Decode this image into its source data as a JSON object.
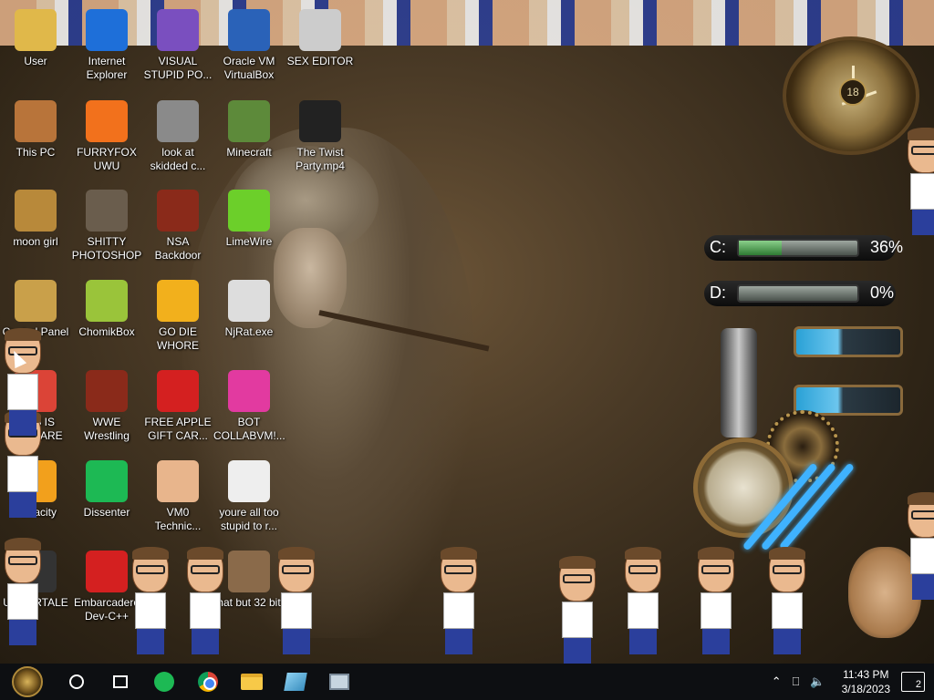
{
  "desktop": {
    "icons": [
      {
        "id": "user",
        "label": "User",
        "icon": "user-folder-icon",
        "color": "#e0b84a"
      },
      {
        "id": "ie",
        "label": "Internet Explorer",
        "icon": "internet-explorer-icon",
        "color": "#1e6fd9"
      },
      {
        "id": "vs",
        "label": "VISUAL STUPID PO...",
        "icon": "visual-studio-icon",
        "color": "#7a4fbf"
      },
      {
        "id": "vbox",
        "label": "Oracle VM VirtualBox",
        "icon": "virtualbox-icon",
        "color": "#2a62b8"
      },
      {
        "id": "sexeditor",
        "label": "SEX EDITOR",
        "icon": "editor-icon",
        "color": "#cccccc"
      },
      {
        "id": "thispc",
        "label": "This PC",
        "icon": "computer-icon",
        "color": "#b8743a"
      },
      {
        "id": "firefox",
        "label": "FURRYFOX UWU",
        "icon": "firefox-icon",
        "color": "#f2711c"
      },
      {
        "id": "skidded",
        "label": "look at skidded c...",
        "icon": "files-icon",
        "color": "#8a8a8a"
      },
      {
        "id": "minecraft",
        "label": "Minecraft",
        "icon": "minecraft-icon",
        "color": "#5d8a3a"
      },
      {
        "id": "twist",
        "label": "The Twist Party.mp4",
        "icon": "video-file-icon",
        "color": "#222222"
      },
      {
        "id": "moongirl",
        "label": "moon girl",
        "icon": "folder-icon",
        "color": "#b8893a"
      },
      {
        "id": "gimp",
        "label": "SHITTY PHOTOSHOP",
        "icon": "gimp-icon",
        "color": "#6a5d4d"
      },
      {
        "id": "nsa",
        "label": "NSA Backdoor",
        "icon": "backdoor-icon",
        "color": "#8a2a1a"
      },
      {
        "id": "limewire",
        "label": "LimeWire",
        "icon": "limewire-icon",
        "color": "#6ccf2a"
      },
      {
        "id": "controlpanel",
        "label": "Control Panel",
        "icon": "control-panel-icon",
        "color": "#c9a04a"
      },
      {
        "id": "chomikbox",
        "label": "ChomikBox",
        "icon": "chomikbox-icon",
        "color": "#9ac43a"
      },
      {
        "id": "godie",
        "label": "GO DIE WHORE",
        "icon": "dreamweaver-icon",
        "color": "#f2b01c"
      },
      {
        "id": "njrat",
        "label": "NjRat.exe",
        "icon": "skull-icon",
        "color": "#dddddd"
      },
      {
        "id": "chrome",
        "label": "THIS IS MALWARE",
        "icon": "chrome-icon",
        "color": "#db4437"
      },
      {
        "id": "wwe",
        "label": "WWE Wrestling",
        "icon": "tv-icon",
        "color": "#8a2a1a"
      },
      {
        "id": "apple",
        "label": "FREE APPLE GIFT CAR...",
        "icon": "apple-icon",
        "color": "#d42020"
      },
      {
        "id": "bot",
        "label": "BOT COLLABVM!...",
        "icon": "bot-icon",
        "color": "#e23aa0"
      },
      {
        "id": "audacity",
        "label": "Audacity",
        "icon": "audacity-icon",
        "color": "#f2a01c"
      },
      {
        "id": "dissenter",
        "label": "Dissenter",
        "icon": "dissenter-icon",
        "color": "#1db954"
      },
      {
        "id": "vm0",
        "label": "VM0 Technic...",
        "icon": "person-icon",
        "color": "#e8b58c"
      },
      {
        "id": "youre",
        "label": "youre all too stupid to r...",
        "icon": "portrait-icon",
        "color": "#eeeeee"
      },
      {
        "id": "undertale",
        "label": "UNDERTALE",
        "icon": "unity-icon",
        "color": "#333333"
      },
      {
        "id": "devcpp",
        "label": "Embarcadero Dev-C++",
        "icon": "devcpp-icon",
        "color": "#d42020"
      },
      {
        "id": "hat",
        "label": "hat but 32 bit",
        "icon": "portrait-icon",
        "color": "#8a6a4a"
      }
    ]
  },
  "gadgets": {
    "clock_date": "18",
    "drives": [
      {
        "letter": "C:",
        "percent": "36%",
        "fill": 0.36
      },
      {
        "letter": "D:",
        "percent": "0%",
        "fill": 0.0
      }
    ]
  },
  "taskbar": {
    "items": [
      {
        "name": "start-button",
        "icon": "start-orb-icon"
      },
      {
        "name": "search-button",
        "icon": "search-icon"
      },
      {
        "name": "task-view-button",
        "icon": "task-view-icon"
      },
      {
        "name": "app-dissenter",
        "icon": "dissenter-icon"
      },
      {
        "name": "app-chrome",
        "icon": "chrome-icon"
      },
      {
        "name": "app-file-explorer",
        "icon": "folder-icon"
      },
      {
        "name": "app-paint",
        "icon": "paint-icon"
      },
      {
        "name": "app-monitor",
        "icon": "monitor-icon"
      }
    ],
    "time": "11:43 PM",
    "date": "3/18/2023",
    "notifications": "2"
  }
}
